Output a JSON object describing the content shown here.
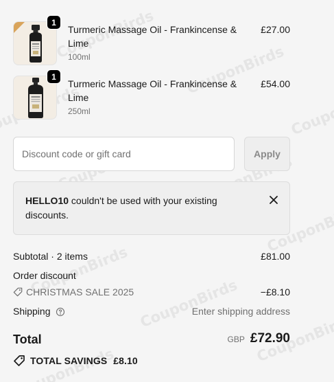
{
  "cart": {
    "items": [
      {
        "title": "Turmeric Massage Oil - Frankincense & Lime",
        "variant": "100ml",
        "price": "£27.00",
        "quantity": "1",
        "image_icon": "amber-bottle-icon"
      },
      {
        "title": "Turmeric Massage Oil - Frankincense & Lime",
        "variant": "250ml",
        "price": "£54.00",
        "quantity": "1",
        "image_icon": "amber-bottle-icon"
      }
    ]
  },
  "discount": {
    "placeholder": "Discount code or gift card",
    "value": "",
    "apply_label": "Apply"
  },
  "notice": {
    "code": "HELLO10",
    "message": " couldn't be used with your existing discounts."
  },
  "summary": {
    "subtotal_label": "Subtotal · 2 items",
    "subtotal_value": "£81.00",
    "order_discount_label": "Order discount",
    "discount_code": "CHRISTMAS SALE 2025",
    "discount_value": "−£8.10",
    "shipping_label": "Shipping",
    "shipping_value": "Enter shipping address",
    "total_label": "Total",
    "currency": "GBP",
    "total_value": "£72.90",
    "savings_label": "TOTAL SAVINGS",
    "savings_value": "£8.10"
  },
  "watermark": {
    "text": "CouponBirds"
  },
  "colors": {
    "background": "#f5f5f5",
    "bottle": "#1c1c1c",
    "thumb_bg": "#f3ede4",
    "muted_text": "#707070"
  }
}
